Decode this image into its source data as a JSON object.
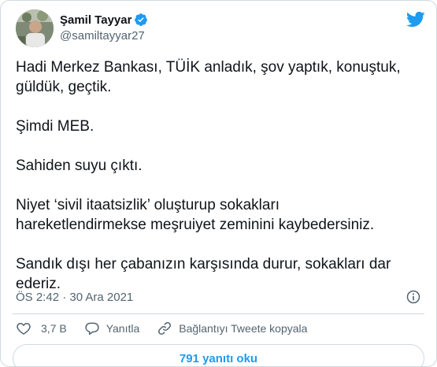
{
  "author": {
    "name": "Şamil Tayyar",
    "handle": "@samiltayyar27",
    "verified": true
  },
  "icons": {
    "platform": "twitter-bird-icon",
    "verified": "verified-badge-icon",
    "info": "info-icon",
    "like": "heart-icon",
    "reply": "reply-bubble-icon",
    "copy": "link-icon"
  },
  "colors": {
    "accent": "#1d9bf0",
    "text": "#0f1419",
    "muted": "#536471",
    "border": "#cfd9de"
  },
  "tweet": {
    "paragraphs": [
      "Hadi Merkez Bankası, TÜİK anladık, şov yaptık, konuştuk,\ngüldük, geçtik.",
      "Şimdi MEB.",
      "Sahiden suyu çıktı.",
      "Niyet ‘sivil itaatsizlik’ oluşturup sokakları\nhareketlendirmekse meşruiyet zeminini kaybedersiniz.",
      "Sandık dışı her çabanızın karşısında durur, sokakları dar\nederiz."
    ],
    "timestamp": "ÖS 2:42 · 30 Ara 2021"
  },
  "actions": {
    "like_count": "3,7 B",
    "reply_label": "Yanıtla",
    "copy_link_label": "Bağlantıyı Tweete kopyala"
  },
  "footer": {
    "read_replies_label": "791 yanıtı oku"
  }
}
